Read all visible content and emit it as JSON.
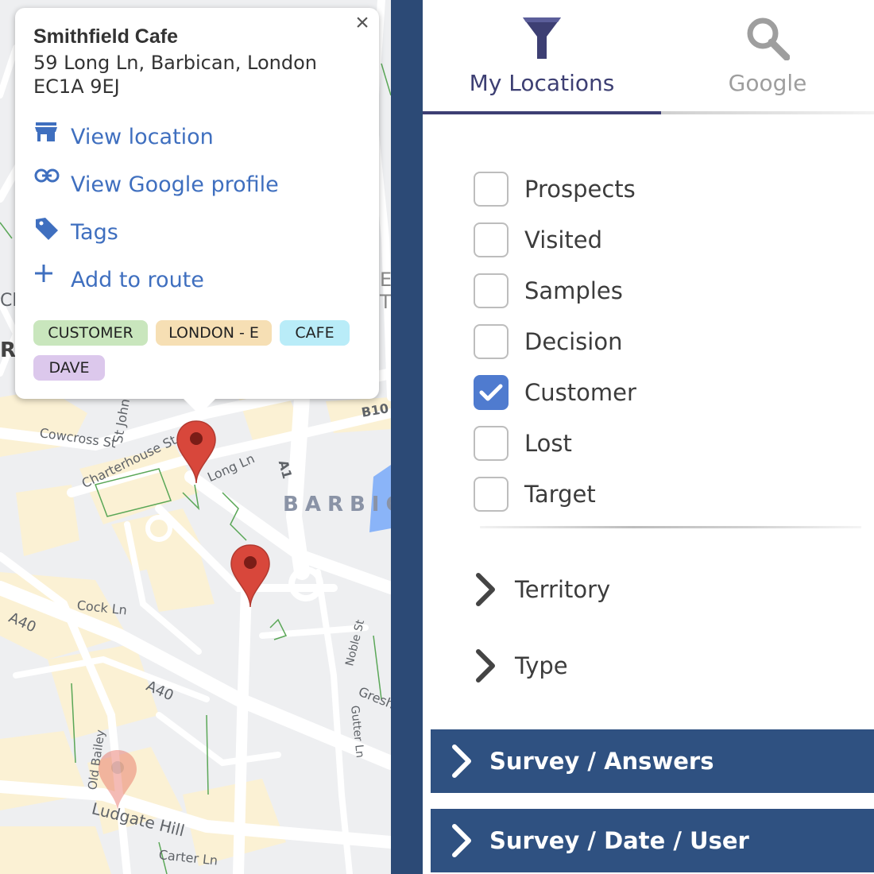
{
  "map": {
    "labels": {
      "cowcross": "Cowcross St",
      "stjohn": "St John",
      "charterhouse": "Charterhouse St",
      "longln": "Long Ln",
      "a1": "A1",
      "b10": "B10",
      "district": "BARBIC",
      "cockln": "Cock Ln",
      "a40_left": "A40",
      "a40_mid": "A40",
      "noble": "Noble St",
      "gresh": "Gresh",
      "gutter": "Gutter Ln",
      "oldbailey": "Old Bailey",
      "ludgate": "Ludgate Hill",
      "carter": "Carter Ln",
      "edge_r": "R",
      "edge_cl": "Cl",
      "edge_e": "E",
      "edge_t": "T"
    }
  },
  "popup": {
    "title": "Smithfield Cafe",
    "address_line1": "59 Long Ln, Barbican, London",
    "address_line2": "EC1A 9EJ",
    "close": "×",
    "actions": {
      "view_location": "View location",
      "view_google": "View Google profile",
      "tags": "Tags",
      "add_route": "Add to route"
    },
    "tags": [
      {
        "label": "CUSTOMER",
        "color": "#c9e6bd"
      },
      {
        "label": "LONDON - E",
        "color": "#f6dfb4"
      },
      {
        "label": "CAFE",
        "color": "#b9ecf8"
      },
      {
        "label": "DAVE",
        "color": "#dcc8ec"
      }
    ]
  },
  "panel": {
    "tabs": {
      "my_locations": "My Locations",
      "google": "Google"
    },
    "filters": [
      {
        "label": "Prospects",
        "checked": false
      },
      {
        "label": "Visited",
        "checked": false
      },
      {
        "label": "Samples",
        "checked": false
      },
      {
        "label": "Decision",
        "checked": false
      },
      {
        "label": "Customer",
        "checked": true
      },
      {
        "label": "Lost",
        "checked": false
      },
      {
        "label": "Target",
        "checked": false
      }
    ],
    "expanders": {
      "territory": "Territory",
      "type": "Type"
    },
    "accordions": {
      "survey_answers": "Survey / Answers",
      "survey_date_user": "Survey / Date / User"
    }
  },
  "colors": {
    "accent": "#3d3f73",
    "link": "#3f6fbf",
    "checkbox_checked": "#4f7bcf",
    "accordion": "#2f5181",
    "pin": "#d8473b"
  }
}
